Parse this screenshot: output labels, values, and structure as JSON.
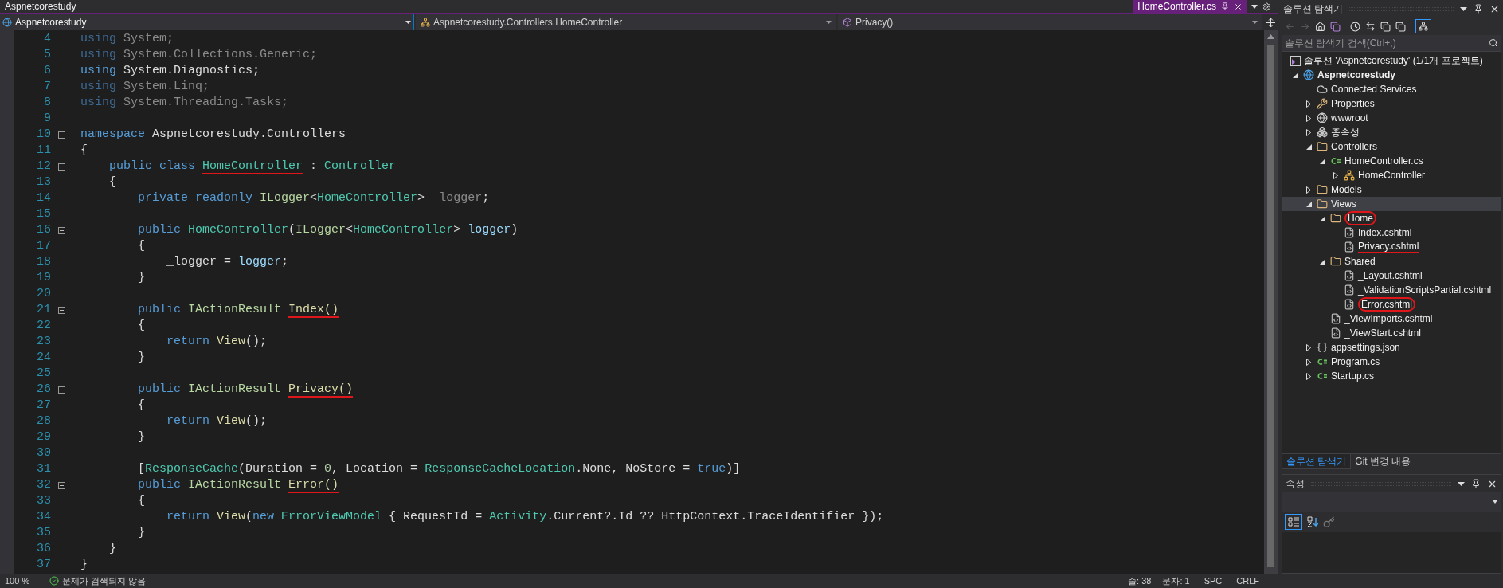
{
  "window": {
    "title": "Aspnetcorestudy"
  },
  "file_tab": {
    "label": "HomeController.cs",
    "selected": true
  },
  "nav_bar": {
    "project": "Aspnetcorestudy",
    "type": "Aspnetcorestudy.Controllers.HomeController",
    "member": "Privacy()"
  },
  "editor": {
    "lines": [
      {
        "number": "4",
        "fold": false,
        "tokens": [
          {
            "kind": "dimkw",
            "text": "using "
          },
          {
            "kind": "dim",
            "text": "System;"
          }
        ]
      },
      {
        "number": "5",
        "fold": false,
        "tokens": [
          {
            "kind": "dimkw",
            "text": "using "
          },
          {
            "kind": "dim",
            "text": "System.Collections.Generic;"
          }
        ]
      },
      {
        "number": "6",
        "fold": false,
        "tokens": [
          {
            "kind": "kw",
            "text": "using "
          },
          {
            "kind": "plain",
            "text": "System.Diagnostics;"
          }
        ]
      },
      {
        "number": "7",
        "fold": false,
        "tokens": [
          {
            "kind": "dimkw",
            "text": "using "
          },
          {
            "kind": "dim",
            "text": "System.Linq;"
          }
        ]
      },
      {
        "number": "8",
        "fold": false,
        "tokens": [
          {
            "kind": "dimkw",
            "text": "using "
          },
          {
            "kind": "dim",
            "text": "System.Threading.Tasks;"
          }
        ]
      },
      {
        "number": "9",
        "fold": false
      },
      {
        "number": "10",
        "fold": true,
        "tokens": [
          {
            "kind": "kw",
            "text": "namespace "
          },
          {
            "kind": "plain",
            "text": "Aspnetcorestudy.Controllers"
          }
        ]
      },
      {
        "number": "11",
        "fold": false,
        "tokens": [
          {
            "kind": "plain",
            "text": "{"
          }
        ]
      },
      {
        "number": "12",
        "fold": true,
        "tokens": [
          {
            "kind": "kw",
            "text": "    public class "
          },
          {
            "kind": "type",
            "text": "HomeController",
            "underlined": true
          },
          {
            "kind": "plain",
            "text": " : "
          },
          {
            "kind": "type",
            "text": "Controller"
          }
        ]
      },
      {
        "number": "13",
        "fold": false,
        "tokens": [
          {
            "kind": "plain",
            "text": "    {"
          }
        ]
      },
      {
        "number": "14",
        "fold": false,
        "tokens": [
          {
            "kind": "kw",
            "text": "        private readonly "
          },
          {
            "kind": "iface",
            "text": "ILogger"
          },
          {
            "kind": "plain",
            "text": "<"
          },
          {
            "kind": "type",
            "text": "HomeController"
          },
          {
            "kind": "plain",
            "text": "> "
          },
          {
            "kind": "dim",
            "text": "_logger"
          },
          {
            "kind": "plain",
            "text": ";"
          }
        ]
      },
      {
        "number": "15",
        "fold": false
      },
      {
        "number": "16",
        "fold": true,
        "tokens": [
          {
            "kind": "kw",
            "text": "        public "
          },
          {
            "kind": "type",
            "text": "HomeController"
          },
          {
            "kind": "plain",
            "text": "("
          },
          {
            "kind": "iface",
            "text": "ILogger"
          },
          {
            "kind": "plain",
            "text": "<"
          },
          {
            "kind": "type",
            "text": "HomeController"
          },
          {
            "kind": "plain",
            "text": "> "
          },
          {
            "kind": "param",
            "text": "logger"
          },
          {
            "kind": "plain",
            "text": ")"
          }
        ]
      },
      {
        "number": "17",
        "fold": false,
        "tokens": [
          {
            "kind": "plain",
            "text": "        {"
          }
        ]
      },
      {
        "number": "18",
        "fold": false,
        "tokens": [
          {
            "kind": "plain",
            "text": "            _logger = "
          },
          {
            "kind": "param",
            "text": "logger"
          },
          {
            "kind": "plain",
            "text": ";"
          }
        ]
      },
      {
        "number": "19",
        "fold": false,
        "tokens": [
          {
            "kind": "plain",
            "text": "        }"
          }
        ]
      },
      {
        "number": "20",
        "fold": false
      },
      {
        "number": "21",
        "fold": true,
        "tokens": [
          {
            "kind": "kw",
            "text": "        public "
          },
          {
            "kind": "iface",
            "text": "IActionResult "
          },
          {
            "kind": "method",
            "text": "Index()",
            "underlined": true
          }
        ]
      },
      {
        "number": "22",
        "fold": false,
        "tokens": [
          {
            "kind": "plain",
            "text": "        {"
          }
        ]
      },
      {
        "number": "23",
        "fold": false,
        "tokens": [
          {
            "kind": "kw",
            "text": "            return "
          },
          {
            "kind": "method",
            "text": "View"
          },
          {
            "kind": "plain",
            "text": "();"
          }
        ]
      },
      {
        "number": "24",
        "fold": false,
        "tokens": [
          {
            "kind": "plain",
            "text": "        }"
          }
        ]
      },
      {
        "number": "25",
        "fold": false
      },
      {
        "number": "26",
        "fold": true,
        "tokens": [
          {
            "kind": "kw",
            "text": "        public "
          },
          {
            "kind": "iface",
            "text": "IActionResult "
          },
          {
            "kind": "method",
            "text": "Privacy()",
            "underlined": true
          }
        ]
      },
      {
        "number": "27",
        "fold": false,
        "tokens": [
          {
            "kind": "plain",
            "text": "        {"
          }
        ]
      },
      {
        "number": "28",
        "fold": false,
        "tokens": [
          {
            "kind": "kw",
            "text": "            return "
          },
          {
            "kind": "method",
            "text": "View"
          },
          {
            "kind": "plain",
            "text": "();"
          }
        ]
      },
      {
        "number": "29",
        "fold": false,
        "tokens": [
          {
            "kind": "plain",
            "text": "        }"
          }
        ]
      },
      {
        "number": "30",
        "fold": false
      },
      {
        "number": "31",
        "fold": false,
        "tokens": [
          {
            "kind": "plain",
            "text": "        ["
          },
          {
            "kind": "type",
            "text": "ResponseCache"
          },
          {
            "kind": "plain",
            "text": "(Duration = "
          },
          {
            "kind": "num",
            "text": "0"
          },
          {
            "kind": "plain",
            "text": ", Location = "
          },
          {
            "kind": "type",
            "text": "ResponseCacheLocation"
          },
          {
            "kind": "plain",
            "text": ".None, NoStore = "
          },
          {
            "kind": "kw",
            "text": "true"
          },
          {
            "kind": "plain",
            "text": ")]"
          }
        ]
      },
      {
        "number": "32",
        "fold": true,
        "tokens": [
          {
            "kind": "kw",
            "text": "        public "
          },
          {
            "kind": "iface",
            "text": "IActionResult "
          },
          {
            "kind": "method",
            "text": "Error()",
            "underlined": true
          }
        ]
      },
      {
        "number": "33",
        "fold": false,
        "tokens": [
          {
            "kind": "plain",
            "text": "        {"
          }
        ]
      },
      {
        "number": "34",
        "fold": false,
        "tokens": [
          {
            "kind": "kw",
            "text": "            return "
          },
          {
            "kind": "method",
            "text": "View"
          },
          {
            "kind": "plain",
            "text": "("
          },
          {
            "kind": "kw",
            "text": "new "
          },
          {
            "kind": "type",
            "text": "ErrorViewModel"
          },
          {
            "kind": "plain",
            "text": " { RequestId = "
          },
          {
            "kind": "type",
            "text": "Activity"
          },
          {
            "kind": "plain",
            "text": ".Current?.Id ?? HttpContext.TraceIdentifier });"
          }
        ]
      },
      {
        "number": "35",
        "fold": false,
        "tokens": [
          {
            "kind": "plain",
            "text": "        }"
          }
        ]
      },
      {
        "number": "36",
        "fold": false,
        "tokens": [
          {
            "kind": "plain",
            "text": "    }"
          }
        ]
      },
      {
        "number": "37",
        "fold": false,
        "tokens": [
          {
            "kind": "plain",
            "text": "}"
          }
        ]
      }
    ]
  },
  "solution_explorer": {
    "title": "솔루션 탐색기",
    "search": {
      "placeholder": "솔루션 탐색기 검색(Ctrl+;)"
    },
    "solution": {
      "label": "솔루션 'Aspnetcorestudy' (1/1개 프로젝트)"
    },
    "items": [
      {
        "label": "Aspnetcorestudy",
        "kind": "project",
        "expanded": true,
        "selected": false,
        "children": [
          {
            "label": "Connected Services",
            "kind": "cloud",
            "selected": false
          },
          {
            "label": "Properties",
            "kind": "properties",
            "expanded": false,
            "selected": false
          },
          {
            "label": "wwwroot",
            "kind": "globe",
            "expanded": false,
            "selected": false
          },
          {
            "label": "종속성",
            "kind": "deps",
            "expanded": false,
            "selected": false
          },
          {
            "label": "Controllers",
            "kind": "folder",
            "expanded": true,
            "selected": false,
            "children": [
              {
                "label": "HomeController.cs",
                "kind": "csharp",
                "expanded": true,
                "selected": false,
                "children": [
                  {
                    "label": "HomeController",
                    "kind": "class",
                    "expanded": false,
                    "selected": false
                  }
                ]
              }
            ]
          },
          {
            "label": "Models",
            "kind": "folder",
            "expanded": false,
            "selected": false
          },
          {
            "label": "Views",
            "kind": "folder",
            "expanded": true,
            "selected": true,
            "children": [
              {
                "label": "Home",
                "kind": "folder",
                "expanded": true,
                "selected": false,
                "circled": true,
                "children": [
                  {
                    "label": "Index.cshtml",
                    "kind": "razor",
                    "selected": false
                  },
                  {
                    "label": "Privacy.cshtml",
                    "kind": "razor",
                    "selected": false,
                    "underlined": true
                  }
                ]
              },
              {
                "label": "Shared",
                "kind": "folder",
                "expanded": true,
                "selected": false,
                "children": [
                  {
                    "label": "_Layout.cshtml",
                    "kind": "razor",
                    "selected": false
                  },
                  {
                    "label": "_ValidationScriptsPartial.cshtml",
                    "kind": "razor",
                    "selected": false
                  },
                  {
                    "label": "Error.cshtml",
                    "kind": "razor",
                    "selected": false,
                    "circled": true
                  }
                ]
              },
              {
                "label": "_ViewImports.cshtml",
                "kind": "razor",
                "selected": false
              },
              {
                "label": "_ViewStart.cshtml",
                "kind": "razor",
                "selected": false
              }
            ]
          },
          {
            "label": "appsettings.json",
            "kind": "json",
            "expanded": false,
            "selected": false
          },
          {
            "label": "Program.cs",
            "kind": "csharp",
            "expanded": false,
            "selected": false
          },
          {
            "label": "Startup.cs",
            "kind": "csharp",
            "expanded": false,
            "selected": false
          }
        ]
      }
    ],
    "tabs": [
      {
        "label": "솔루션 탐색기",
        "selected": true
      },
      {
        "label": "Git 변경 내용",
        "selected": false
      }
    ]
  },
  "properties": {
    "title": "속성"
  },
  "status_bar": {
    "zoom": "100 %",
    "issues": "문제가 검색되지 않음",
    "line": "줄: 38",
    "column": "문자: 1",
    "whitespace": "SPC",
    "line_ending": "CRLF"
  }
}
